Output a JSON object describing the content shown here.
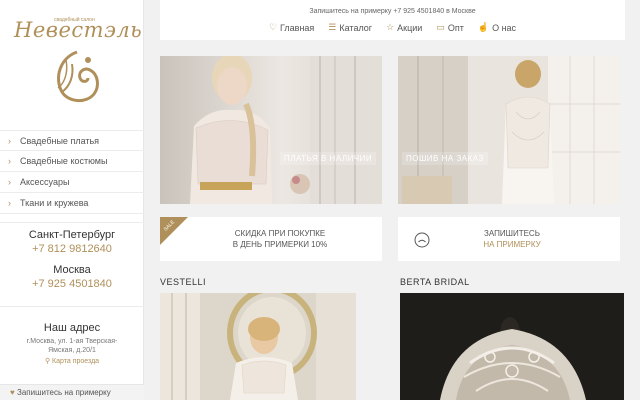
{
  "logo": {
    "name": "Невестэль",
    "subtitle": "свадебный салон"
  },
  "sidebar": {
    "menu": [
      {
        "label": "Свадебные платья"
      },
      {
        "label": "Свадебные костюмы"
      },
      {
        "label": "Аксессуары"
      },
      {
        "label": "Ткани и кружева"
      }
    ],
    "cities": [
      {
        "name": "Санкт-Петербург",
        "phone": "+7 812 9812640"
      },
      {
        "name": "Москва",
        "phone": "+7 925 4501840"
      }
    ],
    "address": {
      "title": "Наш адрес",
      "line1": "г.Москва, ул. 1-ая Тверская-",
      "line2": "Ямская, д.20/1",
      "map_link": "Карта проезда"
    },
    "signup": "Запишитесь на примерку"
  },
  "header": {
    "notice": "Запишитесь на примерку +7 925 4501840 в Москве",
    "nav": [
      {
        "label": "Главная",
        "icon": "heart-icon"
      },
      {
        "label": "Каталог",
        "icon": "list-icon"
      },
      {
        "label": "Акции",
        "icon": "star-icon"
      },
      {
        "label": "Опт",
        "icon": "card-icon"
      },
      {
        "label": "О нас",
        "icon": "hand-icon"
      }
    ]
  },
  "tiles": {
    "in_stock": "ПЛАТЬЯ В НАЛИЧИИ",
    "custom": "ПОШИВ НА ЗАКАЗ"
  },
  "promos": {
    "sale_badge": "SALE",
    "discount_line1": "СКИДКА ПРИ ПОКУПКЕ",
    "discount_line2": "В ДЕНЬ ПРИМЕРКИ 10%",
    "signup_line1": "ЗАПИШИТЕСЬ",
    "signup_line2": "НА ПРИМЕРКУ"
  },
  "brands": [
    "VESTELLI",
    "BERTA BRIDAL"
  ],
  "colors": {
    "accent": "#b0905a",
    "background": "#f1f1f1"
  }
}
